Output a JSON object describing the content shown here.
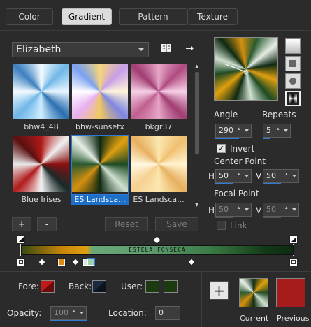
{
  "tabs": [
    {
      "label": "Color"
    },
    {
      "label": "Gradient"
    },
    {
      "label": "Pattern"
    },
    {
      "label": "Texture"
    }
  ],
  "gradient_select": {
    "value": "Elizabeth"
  },
  "thumbnails": [
    {
      "label": "bhw4_48"
    },
    {
      "label": "bhw-sunsetx"
    },
    {
      "label": "bkgr37"
    },
    {
      "label": "Blue Irises"
    },
    {
      "label": "ES Landsca..."
    },
    {
      "label": "ES Landsca..."
    }
  ],
  "buttons": {
    "add": "+",
    "remove": "-",
    "reset": "Reset",
    "save": "Save"
  },
  "angle": {
    "label": "Angle",
    "value": "290"
  },
  "repeats": {
    "label": "Repeats",
    "value": "5"
  },
  "invert": {
    "label": "Invert",
    "checked": true
  },
  "center_point": {
    "label": "Center Point",
    "h_label": "H",
    "h": "50",
    "v_label": "V",
    "v": "50"
  },
  "focal_point": {
    "label": "Focal Point",
    "h_label": "H",
    "h": "50",
    "v_label": "V",
    "v": "50"
  },
  "link": {
    "label": "Link"
  },
  "gradient_bar": {
    "text": "ESTELA FONSECA"
  },
  "bottom": {
    "fore_label": "Fore:",
    "back_label": "Back:",
    "user_label": "User:",
    "opacity_label": "Opacity:",
    "opacity_value": "100",
    "location_label": "Location:",
    "location_value": "0",
    "current_label": "Current",
    "previous_label": "Previous",
    "plus": "+"
  },
  "colors": {
    "accent": "#2a7ad6",
    "previous": "#a61c1c",
    "user_swatch": "#1c3a10"
  }
}
